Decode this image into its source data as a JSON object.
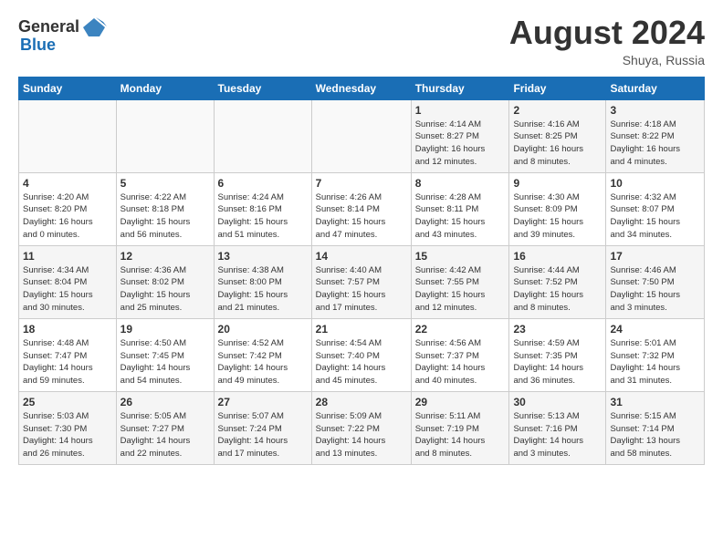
{
  "header": {
    "logo_general": "General",
    "logo_blue": "Blue",
    "title": "August 2024",
    "subtitle": "Shuya, Russia"
  },
  "weekdays": [
    "Sunday",
    "Monday",
    "Tuesday",
    "Wednesday",
    "Thursday",
    "Friday",
    "Saturday"
  ],
  "weeks": [
    [
      {
        "num": "",
        "info": ""
      },
      {
        "num": "",
        "info": ""
      },
      {
        "num": "",
        "info": ""
      },
      {
        "num": "",
        "info": ""
      },
      {
        "num": "1",
        "info": "Sunrise: 4:14 AM\nSunset: 8:27 PM\nDaylight: 16 hours\nand 12 minutes."
      },
      {
        "num": "2",
        "info": "Sunrise: 4:16 AM\nSunset: 8:25 PM\nDaylight: 16 hours\nand 8 minutes."
      },
      {
        "num": "3",
        "info": "Sunrise: 4:18 AM\nSunset: 8:22 PM\nDaylight: 16 hours\nand 4 minutes."
      }
    ],
    [
      {
        "num": "4",
        "info": "Sunrise: 4:20 AM\nSunset: 8:20 PM\nDaylight: 16 hours\nand 0 minutes."
      },
      {
        "num": "5",
        "info": "Sunrise: 4:22 AM\nSunset: 8:18 PM\nDaylight: 15 hours\nand 56 minutes."
      },
      {
        "num": "6",
        "info": "Sunrise: 4:24 AM\nSunset: 8:16 PM\nDaylight: 15 hours\nand 51 minutes."
      },
      {
        "num": "7",
        "info": "Sunrise: 4:26 AM\nSunset: 8:14 PM\nDaylight: 15 hours\nand 47 minutes."
      },
      {
        "num": "8",
        "info": "Sunrise: 4:28 AM\nSunset: 8:11 PM\nDaylight: 15 hours\nand 43 minutes."
      },
      {
        "num": "9",
        "info": "Sunrise: 4:30 AM\nSunset: 8:09 PM\nDaylight: 15 hours\nand 39 minutes."
      },
      {
        "num": "10",
        "info": "Sunrise: 4:32 AM\nSunset: 8:07 PM\nDaylight: 15 hours\nand 34 minutes."
      }
    ],
    [
      {
        "num": "11",
        "info": "Sunrise: 4:34 AM\nSunset: 8:04 PM\nDaylight: 15 hours\nand 30 minutes."
      },
      {
        "num": "12",
        "info": "Sunrise: 4:36 AM\nSunset: 8:02 PM\nDaylight: 15 hours\nand 25 minutes."
      },
      {
        "num": "13",
        "info": "Sunrise: 4:38 AM\nSunset: 8:00 PM\nDaylight: 15 hours\nand 21 minutes."
      },
      {
        "num": "14",
        "info": "Sunrise: 4:40 AM\nSunset: 7:57 PM\nDaylight: 15 hours\nand 17 minutes."
      },
      {
        "num": "15",
        "info": "Sunrise: 4:42 AM\nSunset: 7:55 PM\nDaylight: 15 hours\nand 12 minutes."
      },
      {
        "num": "16",
        "info": "Sunrise: 4:44 AM\nSunset: 7:52 PM\nDaylight: 15 hours\nand 8 minutes."
      },
      {
        "num": "17",
        "info": "Sunrise: 4:46 AM\nSunset: 7:50 PM\nDaylight: 15 hours\nand 3 minutes."
      }
    ],
    [
      {
        "num": "18",
        "info": "Sunrise: 4:48 AM\nSunset: 7:47 PM\nDaylight: 14 hours\nand 59 minutes."
      },
      {
        "num": "19",
        "info": "Sunrise: 4:50 AM\nSunset: 7:45 PM\nDaylight: 14 hours\nand 54 minutes."
      },
      {
        "num": "20",
        "info": "Sunrise: 4:52 AM\nSunset: 7:42 PM\nDaylight: 14 hours\nand 49 minutes."
      },
      {
        "num": "21",
        "info": "Sunrise: 4:54 AM\nSunset: 7:40 PM\nDaylight: 14 hours\nand 45 minutes."
      },
      {
        "num": "22",
        "info": "Sunrise: 4:56 AM\nSunset: 7:37 PM\nDaylight: 14 hours\nand 40 minutes."
      },
      {
        "num": "23",
        "info": "Sunrise: 4:59 AM\nSunset: 7:35 PM\nDaylight: 14 hours\nand 36 minutes."
      },
      {
        "num": "24",
        "info": "Sunrise: 5:01 AM\nSunset: 7:32 PM\nDaylight: 14 hours\nand 31 minutes."
      }
    ],
    [
      {
        "num": "25",
        "info": "Sunrise: 5:03 AM\nSunset: 7:30 PM\nDaylight: 14 hours\nand 26 minutes."
      },
      {
        "num": "26",
        "info": "Sunrise: 5:05 AM\nSunset: 7:27 PM\nDaylight: 14 hours\nand 22 minutes."
      },
      {
        "num": "27",
        "info": "Sunrise: 5:07 AM\nSunset: 7:24 PM\nDaylight: 14 hours\nand 17 minutes."
      },
      {
        "num": "28",
        "info": "Sunrise: 5:09 AM\nSunset: 7:22 PM\nDaylight: 14 hours\nand 13 minutes."
      },
      {
        "num": "29",
        "info": "Sunrise: 5:11 AM\nSunset: 7:19 PM\nDaylight: 14 hours\nand 8 minutes."
      },
      {
        "num": "30",
        "info": "Sunrise: 5:13 AM\nSunset: 7:16 PM\nDaylight: 14 hours\nand 3 minutes."
      },
      {
        "num": "31",
        "info": "Sunrise: 5:15 AM\nSunset: 7:14 PM\nDaylight: 13 hours\nand 58 minutes."
      }
    ]
  ]
}
